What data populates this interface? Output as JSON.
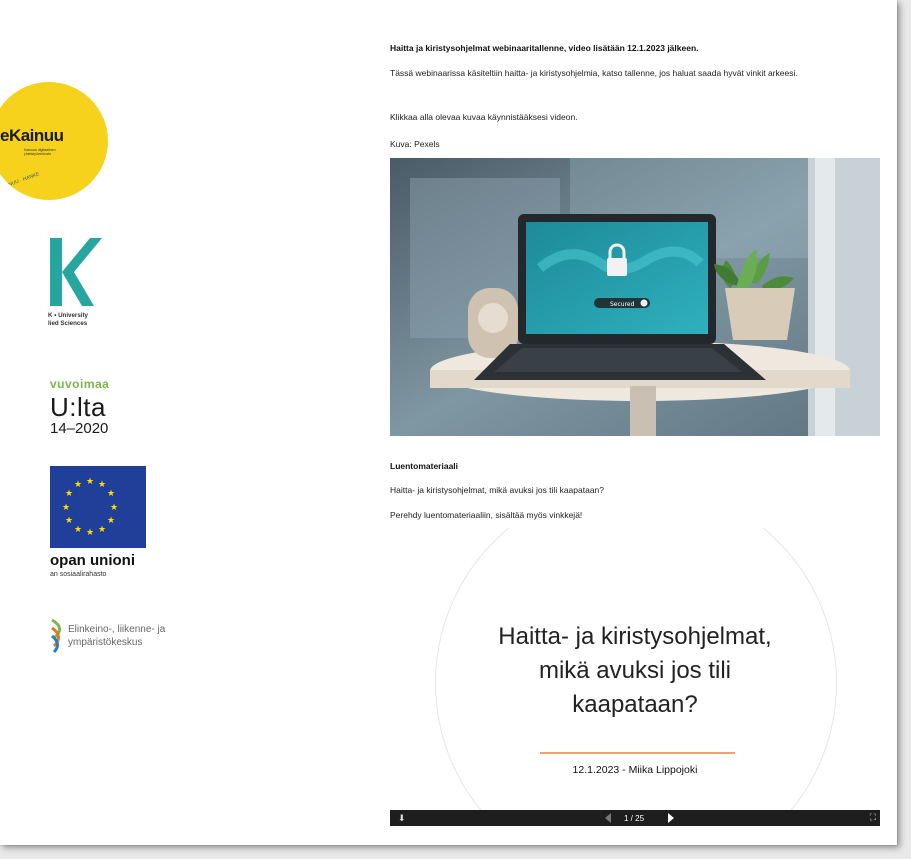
{
  "logos": {
    "kainuu_word": "eKainuu",
    "kainuu_sub": "Kainuun digitaalinen yhteistyöverkosto",
    "kainuu_arc": "KAINUU · HANKE",
    "kamk_lines": [
      "K • University",
      "lied Sciences"
    ],
    "vipu_top": "vuvoimaa",
    "vipu_main": "U:lta",
    "vipu_years": "14–2020",
    "eu_name": "opan unioni",
    "eu_sub": "an sosiaalirahasto",
    "ely_lines": [
      "Elinkeino-, liikenne- ja",
      "ympäristökeskus"
    ]
  },
  "content": {
    "title": "Haitta ja kiristysohjelmat webinaaritallenne, video lisätään 12.1.2023 jälkeen.",
    "intro": "Tässä webinaarissa käsiteltiin haitta- ja kiristysohjelmia, katso tallenne, jos haluat saada hyvät vinkit arkeesi.",
    "click_hint": "Klikkaa alla olevaa kuvaa käynnistääksesi videon.",
    "photo_credit": "Kuva: Pexels",
    "screen_badge": "Secured",
    "materials_heading": "Luentomateriaali",
    "materials_link": "Haitta- ja kiristysohjelmat, mikä avuksi jos tili kaapataan?",
    "materials_note": "Perehdy luentomateriaaliin, sisältää myös vinkkejä!"
  },
  "slide": {
    "heading_lines": [
      "Haitta- ja kiristysohjelmat,",
      "mikä avuksi jos tili",
      "kaapataan?"
    ],
    "date_author": "12.1.2023 - Miika Lippojoki",
    "page_indicator": "1 / 25"
  },
  "colors": {
    "kainuu_yellow": "#f6d21c",
    "kamk_teal": "#27a6a0",
    "vipu_green": "#7ab648",
    "eu_blue": "#1f3f99",
    "eu_star": "#ffdd00",
    "slide_accent": "#f0a071"
  }
}
